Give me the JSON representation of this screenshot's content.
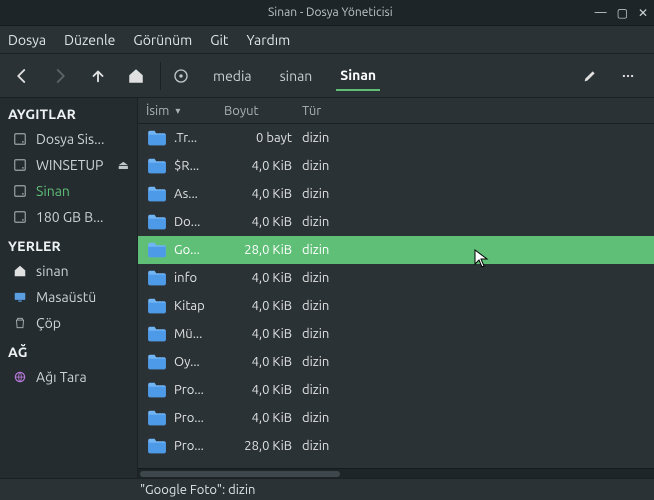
{
  "window": {
    "title": "Sinan - Dosya Yöneticisi"
  },
  "menubar": {
    "items": [
      "Dosya",
      "Düzenle",
      "Görünüm",
      "Git",
      "Yardım"
    ]
  },
  "breadcrumb": {
    "items": [
      "media",
      "sinan",
      "Sinan"
    ],
    "active_index": 2
  },
  "columns": {
    "name": "İsim",
    "size": "Boyut",
    "type": "Tür"
  },
  "sidebar": {
    "sections": [
      {
        "title": "AYGITLAR",
        "items": [
          {
            "icon": "disk",
            "label": "Dosya Sis..."
          },
          {
            "icon": "disk",
            "label": "WINSETUP",
            "eject": true
          },
          {
            "icon": "disk",
            "label": "Sinan",
            "active": true
          },
          {
            "icon": "disk",
            "label": "180 GB B..."
          }
        ]
      },
      {
        "title": "YERLER",
        "items": [
          {
            "icon": "home",
            "label": "sinan"
          },
          {
            "icon": "desktop",
            "label": "Masaüstü"
          },
          {
            "icon": "trash",
            "label": "Çöp"
          }
        ]
      },
      {
        "title": "AĞ",
        "items": [
          {
            "icon": "network",
            "label": "Ağı Tara"
          }
        ]
      }
    ]
  },
  "files": [
    {
      "name": ".Tr...",
      "size": "0 bayt",
      "type": "dizin"
    },
    {
      "name": "$R...",
      "size": "4,0 KiB",
      "type": "dizin"
    },
    {
      "name": "As...",
      "size": "4,0 KiB",
      "type": "dizin"
    },
    {
      "name": "Do...",
      "size": "4,0 KiB",
      "type": "dizin"
    },
    {
      "name": "Go...",
      "size": "28,0 KiB",
      "type": "dizin",
      "selected": true
    },
    {
      "name": "info",
      "size": "4,0 KiB",
      "type": "dizin"
    },
    {
      "name": "Kitap",
      "size": "4,0 KiB",
      "type": "dizin"
    },
    {
      "name": "Mü...",
      "size": "4,0 KiB",
      "type": "dizin"
    },
    {
      "name": "Oy...",
      "size": "4,0 KiB",
      "type": "dizin"
    },
    {
      "name": "Pro...",
      "size": "4,0 KiB",
      "type": "dizin"
    },
    {
      "name": "Pro...",
      "size": "4,0 KiB",
      "type": "dizin"
    },
    {
      "name": "Pro...",
      "size": "28,0 KiB",
      "type": "dizin"
    }
  ],
  "statusbar": {
    "text": "\"Google Foto\": dizin"
  },
  "colors": {
    "selection": "#5fbf77",
    "folder_light": "#6fb4f4",
    "folder_dark": "#3d8fe0"
  }
}
